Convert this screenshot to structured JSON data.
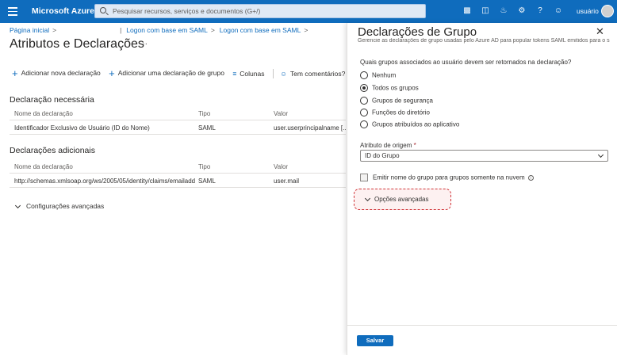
{
  "topbar": {
    "brand": "Microsoft Azure",
    "search_placeholder": "Pesquisar recursos, serviços e documentos (G+/)",
    "icons": [
      "cloud-shell-icon",
      "directory-filter-icon",
      "bell-icon",
      "gear-icon",
      "help-icon",
      "feedback-icon"
    ],
    "user": "usuário"
  },
  "breadcrumb": {
    "home": "Página inicial",
    "item1": "Logon com base em SAML",
    "item2": "Logon com base em SAML"
  },
  "page": {
    "title": "Atributos e Declarações",
    "more": "···"
  },
  "toolbar": {
    "add_claim": "Adicionar nova declaração",
    "add_group_claim": "Adicionar uma declaração de grupo",
    "columns": "Colunas",
    "feedback": "Tem comentários?"
  },
  "required": {
    "heading": "Declaração necessária",
    "columns": [
      "Nome da declaração",
      "Tipo",
      "Valor"
    ],
    "rows": [
      [
        "Identificador Exclusivo de Usuário (ID do Nome)",
        "SAML",
        "user.userprincipalname [..."
      ]
    ]
  },
  "additional": {
    "heading": "Declarações adicionais",
    "columns": [
      "Nome da declaração",
      "Tipo",
      "Valor"
    ],
    "rows": [
      [
        "http://schemas.xmlsoap.org/ws/2005/05/identity/claims/emailadd...",
        "SAML",
        "user.mail"
      ]
    ]
  },
  "advanced": "Configurações avançadas",
  "panel": {
    "title": "Declarações de Grupo",
    "subtitle": "Gerencie as declarações de grupo usadas pelo Azure AD para popular tokens SAML emitidos para o s",
    "question": "Quais grupos associados ao usuário devem ser retornados na declaração?",
    "options": [
      "Nenhum",
      "Todos os grupos",
      "Grupos de segurança",
      "Funções do diretório",
      "Grupos atribuídos ao aplicativo"
    ],
    "selected_option": "Todos os grupos",
    "source_label": "Atributo de origem",
    "required_mark": "*",
    "source_value": "ID do Grupo",
    "cloud_only": "Emitir nome do grupo para grupos somente na nuvem",
    "info": "i",
    "advanced_options": "Opções avançadas",
    "save": "Salvar"
  },
  "colors": {
    "accent": "#0f6cbd",
    "highlight_border": "#d13438"
  }
}
